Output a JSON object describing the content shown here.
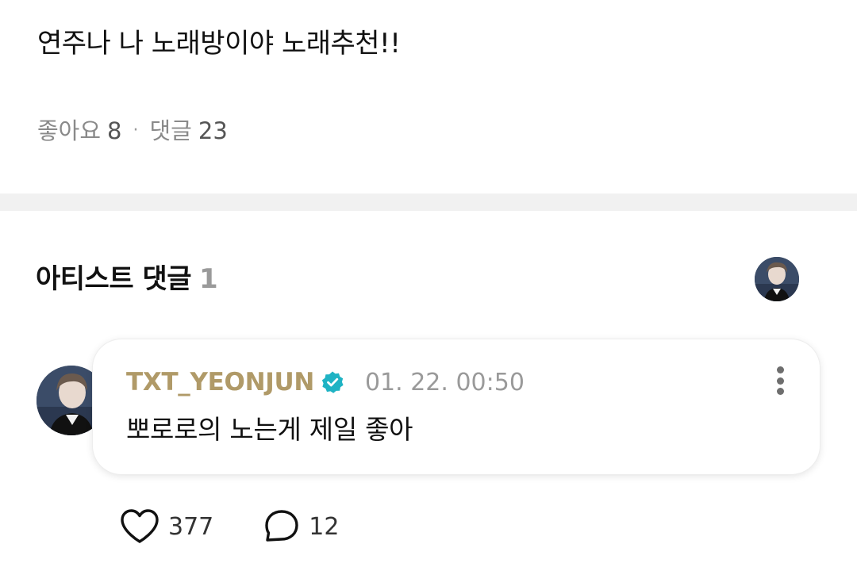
{
  "post": {
    "text": "연주나 나 노래방이야 노래추천!!",
    "likes_label": "좋아요",
    "likes_count": "8",
    "separator": "·",
    "comments_label": "댓글",
    "comments_count": "23"
  },
  "artist_comments": {
    "title": "아티스트 댓글",
    "count": "1"
  },
  "comment": {
    "author": "TXT_YEONJUN",
    "verified_icon": "verified-badge-icon",
    "timestamp": "01. 22. 00:50",
    "text": "뽀로로의 노는게 제일 좋아",
    "like_count": "377",
    "reply_count": "12"
  },
  "colors": {
    "author_gold": "#b09a68",
    "verified_teal": "#1fb3c4",
    "muted_text": "#8a8a8a",
    "divider_gray": "#f1f1f1"
  }
}
